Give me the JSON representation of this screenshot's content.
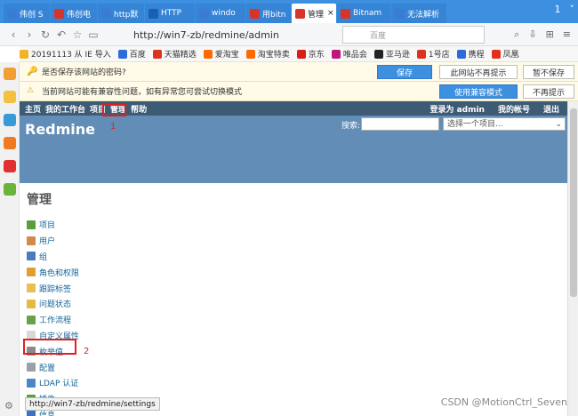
{
  "browser": {
    "tabs": [
      {
        "label": "伟创 S",
        "color": "#3a7bd5",
        "active": false
      },
      {
        "label": "伟创电",
        "color": "#d9342b",
        "active": false
      },
      {
        "label": "http默",
        "color": "#3a7bd5",
        "active": false
      },
      {
        "label": "HTTP",
        "color": "#1a5fb4",
        "active": false
      },
      {
        "label": "windo",
        "color": "#3a7bd5",
        "active": false
      },
      {
        "label": "用bitn",
        "color": "#d9342b",
        "active": false
      },
      {
        "label": "管理",
        "color": "#d9342b",
        "active": true
      },
      {
        "label": "Bitnam",
        "color": "#d9342b",
        "active": false
      },
      {
        "label": "无法解析",
        "color": "#3a7bd5",
        "active": false
      }
    ],
    "tab_count": "1",
    "url": "http://win7-zb/redmine/admin",
    "search_placeholder": "百度",
    "favorites": [
      {
        "label": "20191113 从 IE 导入",
        "color": "#f0b429"
      },
      {
        "label": "百度",
        "color": "#2b6cd8"
      },
      {
        "label": "天猫精选",
        "color": "#e0301e"
      },
      {
        "label": "爱淘宝",
        "color": "#ff6a00"
      },
      {
        "label": "淘宝特卖",
        "color": "#ff6a00"
      },
      {
        "label": "京东",
        "color": "#d71e17"
      },
      {
        "label": "唯品会",
        "color": "#c0157c"
      },
      {
        "label": "亚马逊",
        "color": "#222222"
      },
      {
        "label": "1号店",
        "color": "#e0301e"
      },
      {
        "label": "携程",
        "color": "#2b6cd8"
      },
      {
        "label": "凤凰",
        "color": "#e0301e"
      }
    ]
  },
  "password_bar": {
    "text": "是否保存该网站的密码?",
    "save": "保存",
    "never": "此网站不再提示",
    "not_now": "暂不保存"
  },
  "compat_bar": {
    "text": "当前网站可能有兼容性问题，如有异常您可尝试切换模式",
    "switch": "使用兼容模式",
    "dismiss": "不再提示"
  },
  "redmine": {
    "menu": [
      "主页",
      "我的工作台",
      "项目",
      "管理",
      "帮助"
    ],
    "logged_in": "登录为 admin",
    "my_account": "我的帐号",
    "logout": "退出",
    "title": "Redmine",
    "search_label": "搜索:",
    "project_select": "选择一个项目...",
    "page_title": "管理",
    "admin_items": [
      {
        "label": "项目",
        "icon": "#5a9e3a"
      },
      {
        "label": "用户",
        "icon": "#d4884a"
      },
      {
        "label": "组",
        "icon": "#4a7bbf"
      },
      {
        "label": "角色和权限",
        "icon": "#e0a030"
      },
      {
        "label": "跟踪标签",
        "icon": "#e8c050"
      },
      {
        "label": "问题状态",
        "icon": "#e8b840"
      },
      {
        "label": "工作流程",
        "icon": "#6aa04a"
      },
      {
        "label": "自定义属性",
        "icon": "#d8d8d8"
      },
      {
        "label": "枚举值",
        "icon": "#8a8a8a"
      },
      {
        "label": "配置",
        "icon": "#9aa0a8"
      },
      {
        "label": "LDAP 认证",
        "icon": "#4a86c8"
      },
      {
        "label": "插件",
        "icon": "#5aa03a"
      },
      {
        "label": "信息",
        "icon": "#3a72c4"
      }
    ]
  },
  "annotations": {
    "one": "1",
    "two": "2"
  },
  "status_url": "http://win7-zb/redmine/settings",
  "watermark": "CSDN @MotionCtrl_Seven"
}
